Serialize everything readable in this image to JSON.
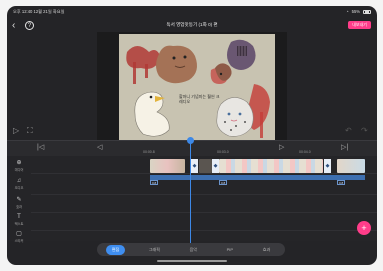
{
  "status": {
    "time_date": "오후 12:40  12월 21일 화요일",
    "battery": "55%"
  },
  "header": {
    "back_glyph": "‹",
    "help_glyph": "?",
    "title": "독서 영업맛동기 (1화 0) 편",
    "export_label": "내보내기"
  },
  "preview": {
    "drawing_text": "할마니 기념미는 훨씬 크레디오",
    "play_glyph": "▷",
    "fullscreen_glyph": "⛶",
    "undo_glyph": "↶",
    "redo_glyph": "↷"
  },
  "transport": {
    "glyphs": [
      "|◁",
      "◁",
      "▷",
      "▷|"
    ],
    "times": [
      "00:00.8",
      "00:03.0",
      "00:04.0"
    ]
  },
  "side_tools": [
    {
      "icon": "⊕",
      "label": "미디어"
    },
    {
      "icon": "♫",
      "label": "오디오"
    },
    {
      "icon": "✎",
      "label": "효과"
    },
    {
      "icon": "T",
      "label": "텍스트"
    },
    {
      "icon": "▢",
      "label": "스티커"
    }
  ],
  "timeline": {
    "bar_labels": [
      "0.8",
      "0.8",
      "0.8"
    ],
    "handle_glyph": "◆"
  },
  "fab_glyph": "+",
  "tabs": [
    "편집",
    "그래픽",
    "음악",
    "PIP",
    "효과"
  ],
  "colors": {
    "accent": "#3f8ef0",
    "export": "#ff3d8a"
  }
}
